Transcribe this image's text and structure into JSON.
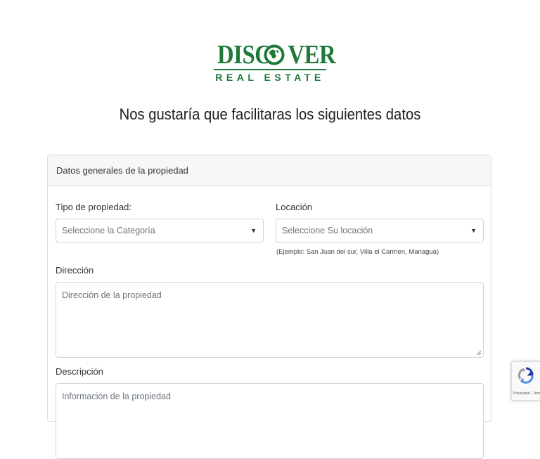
{
  "logo": {
    "word_left": "DISC",
    "word_right": "VER",
    "subtitle": "REAL ESTATE",
    "color": "#1f7a3a"
  },
  "heading": "Nos gustaría que facilitaras los siguientes datos",
  "card": {
    "header": "Datos generales de la propiedad",
    "tipo": {
      "label": "Tipo de propiedad:",
      "selected": "Seleccione la Categoría",
      "arrow_icon": "caret-down-icon"
    },
    "locacion": {
      "label": "Locación",
      "selected": "Seleccione Su locación",
      "hint": "(Ejemplo: San Juan del sur, Villa el Carmen, Managua)",
      "arrow_icon": "caret-down-icon"
    },
    "direccion": {
      "label": "Dirección",
      "placeholder": "Dirección de la propiedad",
      "value": ""
    },
    "descripcion": {
      "label": "Descripción",
      "placeholder": "Información de la propiedad",
      "value": ""
    }
  },
  "recaptcha": {
    "text": "Privacidad - Términos",
    "icon": "recaptcha-icon"
  }
}
